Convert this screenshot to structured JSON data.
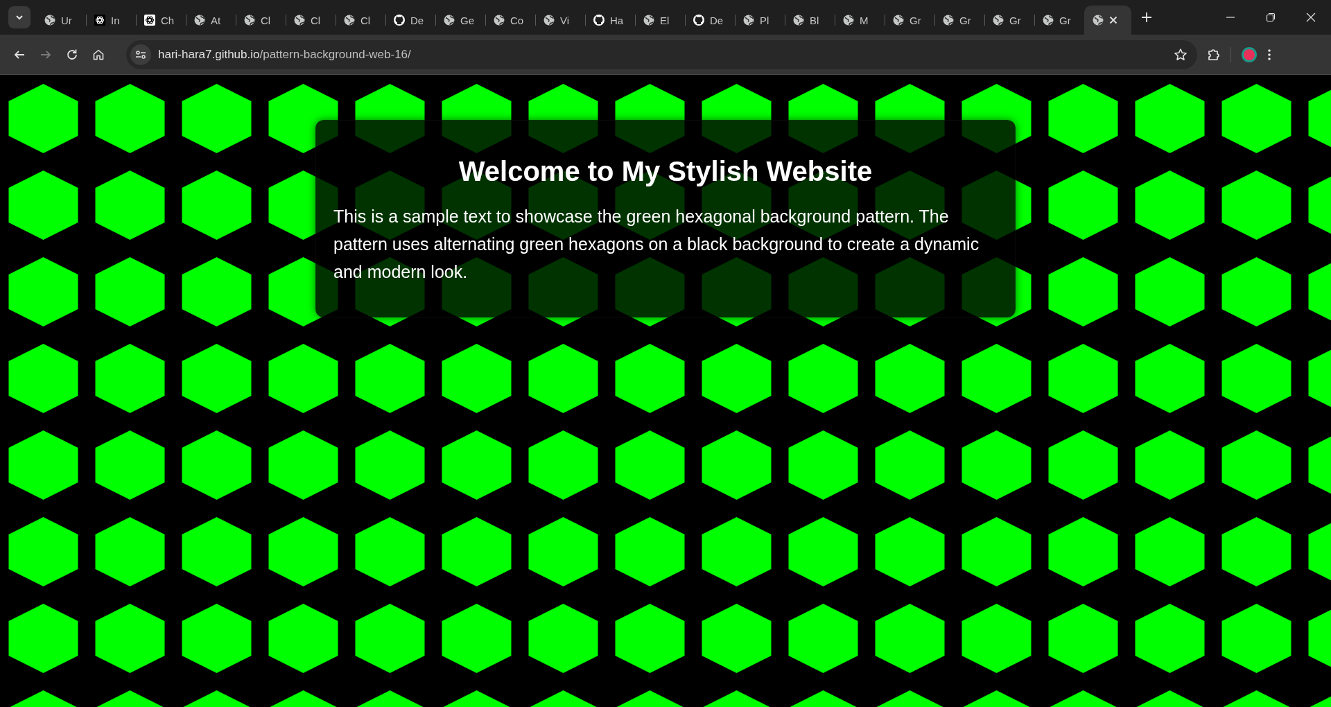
{
  "tabs": [
    {
      "label": "Ur",
      "kind": "globe",
      "selected": false
    },
    {
      "label": "In",
      "kind": "knotdark",
      "selected": false
    },
    {
      "label": "Ch",
      "kind": "knotlight",
      "selected": false
    },
    {
      "label": "At",
      "kind": "globe",
      "selected": false
    },
    {
      "label": "Cl",
      "kind": "globe",
      "selected": false
    },
    {
      "label": "Cl",
      "kind": "globe",
      "selected": false
    },
    {
      "label": "Cl",
      "kind": "globe",
      "selected": false
    },
    {
      "label": "De",
      "kind": "cat",
      "selected": false
    },
    {
      "label": "Ge",
      "kind": "globe",
      "selected": false
    },
    {
      "label": "Co",
      "kind": "globe",
      "selected": false
    },
    {
      "label": "Vi",
      "kind": "globe",
      "selected": false
    },
    {
      "label": "Ha",
      "kind": "cat",
      "selected": false
    },
    {
      "label": "El",
      "kind": "globe",
      "selected": false
    },
    {
      "label": "De",
      "kind": "cat",
      "selected": false
    },
    {
      "label": "Pl",
      "kind": "globe",
      "selected": false
    },
    {
      "label": "Bl",
      "kind": "globe",
      "selected": false
    },
    {
      "label": "M",
      "kind": "globe",
      "selected": false
    },
    {
      "label": "Gr",
      "kind": "globe",
      "selected": false
    },
    {
      "label": "Gr",
      "kind": "globe",
      "selected": false
    },
    {
      "label": "Gr",
      "kind": "globe",
      "selected": false
    },
    {
      "label": "Gr",
      "kind": "globe",
      "selected": false
    },
    {
      "kind": "globe",
      "selected": true
    }
  ],
  "navigation": {
    "back": {
      "disabled": false
    },
    "forward": {
      "disabled": true
    }
  },
  "address_bar": {
    "host": "hari-hara7.github.io",
    "path": "/pattern-background-web-16/"
  },
  "page": {
    "heading": "Welcome to My Stylish Website",
    "paragraph": "This is a sample text to showcase the green hexagonal background pattern. The pattern uses alternating green hexagons on a black background to create a dynamic and modern look."
  }
}
